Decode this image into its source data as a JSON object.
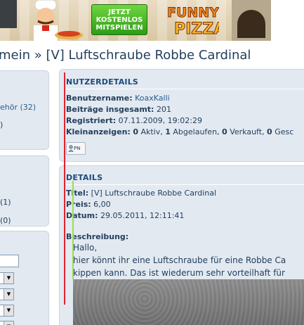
{
  "banner": {
    "cta_label": "JETZT KOSTENLOS MITSPIELEN",
    "game_logo": "FUNNY PIZZA",
    "colors": {
      "cta": "#3aa71f",
      "logo": "#f58a1a"
    }
  },
  "page_title": "mein » [V] Luftschraube Robbe Cardinal",
  "sidebar": {
    "panel1": {
      "line1": "ehör (32)",
      "line2": ")"
    },
    "panel2": {
      "line1": "(1)",
      "line2": "(0)"
    }
  },
  "user_details": {
    "heading": "NUTZERDETAILS",
    "username_label": "Benutzername:",
    "username": "KoaxKalli",
    "posts_label": "Beiträge insgesamt:",
    "posts": "201",
    "registered_label": "Registriert:",
    "registered": "07.11.2009, 19:02:29",
    "ads_label": "Kleinanzeigen:",
    "ads_active": "0",
    "ads_active_label": "Aktiv,",
    "ads_expired": "1",
    "ads_expired_label": "Abgelaufen,",
    "ads_sold": "0",
    "ads_sold_label": "Verkauft,",
    "ads_other": "0",
    "ads_other_label": "Gesc",
    "pm_label": "PN"
  },
  "details": {
    "heading": "DETAILS",
    "title_label": "Titel:",
    "title": "[V] Luftschraube Robbe Cardinal",
    "price_label": "Preis:",
    "price": "6,00",
    "date_label": "Datum:",
    "date": "29.05.2011, 12:11:41",
    "description_label": "Beschreibung:",
    "description_lines": [
      "Hallo,",
      "hier könnt ihr eine Luftschraube für eine Robbe Ca",
      "kippen kann. Das ist wiederum sehr vorteilhaft für"
    ]
  }
}
